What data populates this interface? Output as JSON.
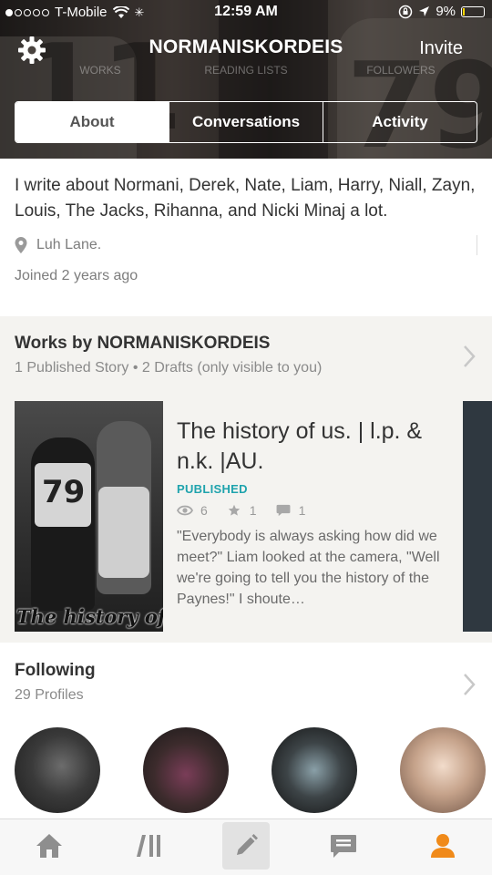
{
  "status_bar": {
    "carrier": "T-Mobile",
    "time": "12:59 AM",
    "battery": "9%",
    "battery_level": 0.09
  },
  "header": {
    "username": "NORMANISKORDEIS",
    "invite_label": "Invite",
    "stats": {
      "works_label": "WORKS",
      "reading_lists_label": "READING LISTS",
      "followers_label": "FOLLOWERS"
    }
  },
  "tabs": [
    {
      "label": "About",
      "active": true
    },
    {
      "label": "Conversations",
      "active": false
    },
    {
      "label": "Activity",
      "active": false
    }
  ],
  "about": {
    "bio": "I write about Normani, Derek, Nate, Liam, Harry, Niall, Zayn, Louis, The Jacks, Rihanna, and Nicki Minaj a lot.",
    "location": "Luh Lane.",
    "joined": "Joined 2 years ago"
  },
  "works": {
    "title": "Works by NORMANISKORDEIS",
    "subtitle": "1 Published Story • 2 Drafts (only visible to you)",
    "story": {
      "cover_text": "The history of us",
      "cover_number": "79",
      "title": "The history of us. | l.p. & n.k. |AU.",
      "status": "PUBLISHED",
      "views": "6",
      "votes": "1",
      "comments": "1",
      "blurb": "\"Everybody is always asking how did we meet?\" Liam looked at the camera, \"Well we're going to tell you the history of the Paynes!\" I shoute…"
    }
  },
  "following": {
    "title": "Following",
    "subtitle": "29 Profiles"
  },
  "tab_bar": {
    "items": [
      "home-icon",
      "library-icon",
      "write-icon",
      "messages-icon",
      "profile-icon"
    ],
    "active": "profile-icon"
  },
  "colors": {
    "accent_teal": "#1fa3ad",
    "active_orange": "#f08a19",
    "icon_gray": "#8e8e8e"
  }
}
